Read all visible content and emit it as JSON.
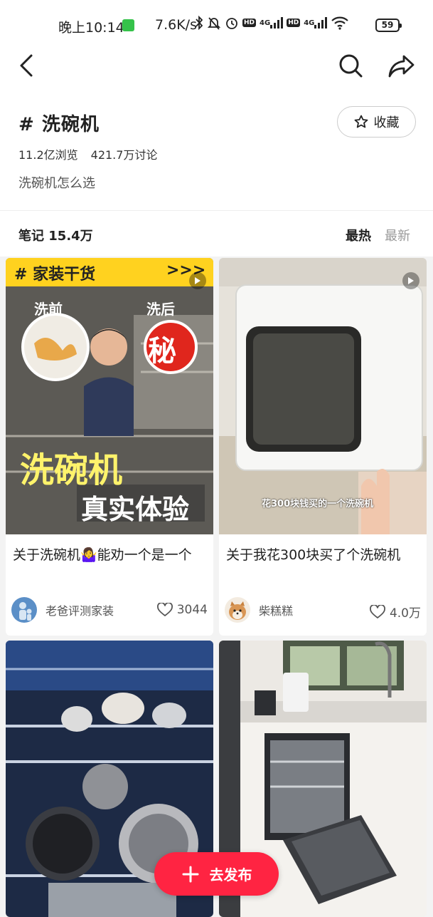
{
  "status_bar": {
    "time": "晚上10:14",
    "net_speed": "7.6K/s",
    "hd1": "HD",
    "net1": "4G",
    "hd2": "HD",
    "net2": "4G",
    "battery": "59"
  },
  "topic": {
    "title": "# 洗碗机",
    "views": "11.2亿浏览",
    "discussions": "421.7万讨论",
    "description": "洗碗机怎么选",
    "favorite_label": "收藏"
  },
  "notes": {
    "count_label": "笔记 15.4万",
    "sort_hot": "最热",
    "sort_new": "最新"
  },
  "cards": [
    {
      "thumb_text": {
        "banner": "# 家装干货",
        "arrows": ">>>",
        "before": "洗前",
        "after": "洗后",
        "secret": "秘",
        "big1": "洗碗机",
        "big2": "真实体验"
      },
      "title": "关于洗碗机🤷‍♀️能劝一个是一个",
      "user": "老爸评测家装",
      "likes": "3044"
    },
    {
      "thumb_text": {
        "caption": "花300块钱买的一个洗碗机"
      },
      "title": "关于我花300块买了个洗碗机",
      "user": "柴糕糕",
      "likes": "4.0万"
    },
    {
      "title": "",
      "user": "",
      "likes": ""
    },
    {
      "title": "",
      "user": "",
      "likes": ""
    }
  ],
  "publish": {
    "label": "去发布"
  },
  "colors": {
    "accent": "#ff2442",
    "banner_yellow": "#ffd21f",
    "secret_red": "#e0261d"
  }
}
